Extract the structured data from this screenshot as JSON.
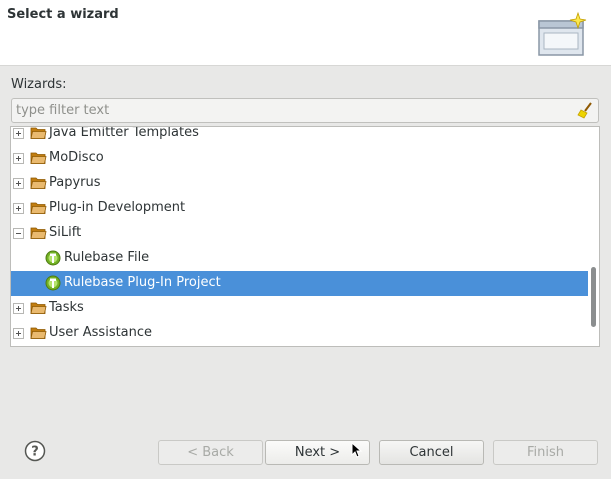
{
  "header": {
    "title": "Select a wizard"
  },
  "wizards_label": "Wizards:",
  "filter": {
    "value": "",
    "placeholder": "type filter text"
  },
  "tree": {
    "items": [
      {
        "label": "Java Emitter Templates",
        "level": 0,
        "kind": "folder",
        "expanded": false
      },
      {
        "label": "MoDisco",
        "level": 0,
        "kind": "folder",
        "expanded": false
      },
      {
        "label": "Papyrus",
        "level": 0,
        "kind": "folder",
        "expanded": false
      },
      {
        "label": "Plug-in Development",
        "level": 0,
        "kind": "folder",
        "expanded": false
      },
      {
        "label": "SiLift",
        "level": 0,
        "kind": "folder",
        "expanded": true
      },
      {
        "label": "Rulebase File",
        "level": 1,
        "kind": "wizard",
        "selected": false
      },
      {
        "label": "Rulebase Plug-In Project",
        "level": 1,
        "kind": "wizard",
        "selected": true
      },
      {
        "label": "Tasks",
        "level": 0,
        "kind": "folder",
        "expanded": false
      },
      {
        "label": "User Assistance",
        "level": 0,
        "kind": "folder",
        "expanded": false
      }
    ]
  },
  "buttons": {
    "back": "< Back",
    "next": "Next >",
    "cancel": "Cancel",
    "finish": "Finish"
  },
  "colors": {
    "selection": "#4a90d9",
    "folder": "#e9b96e",
    "wizard_icon": "#73b224"
  }
}
